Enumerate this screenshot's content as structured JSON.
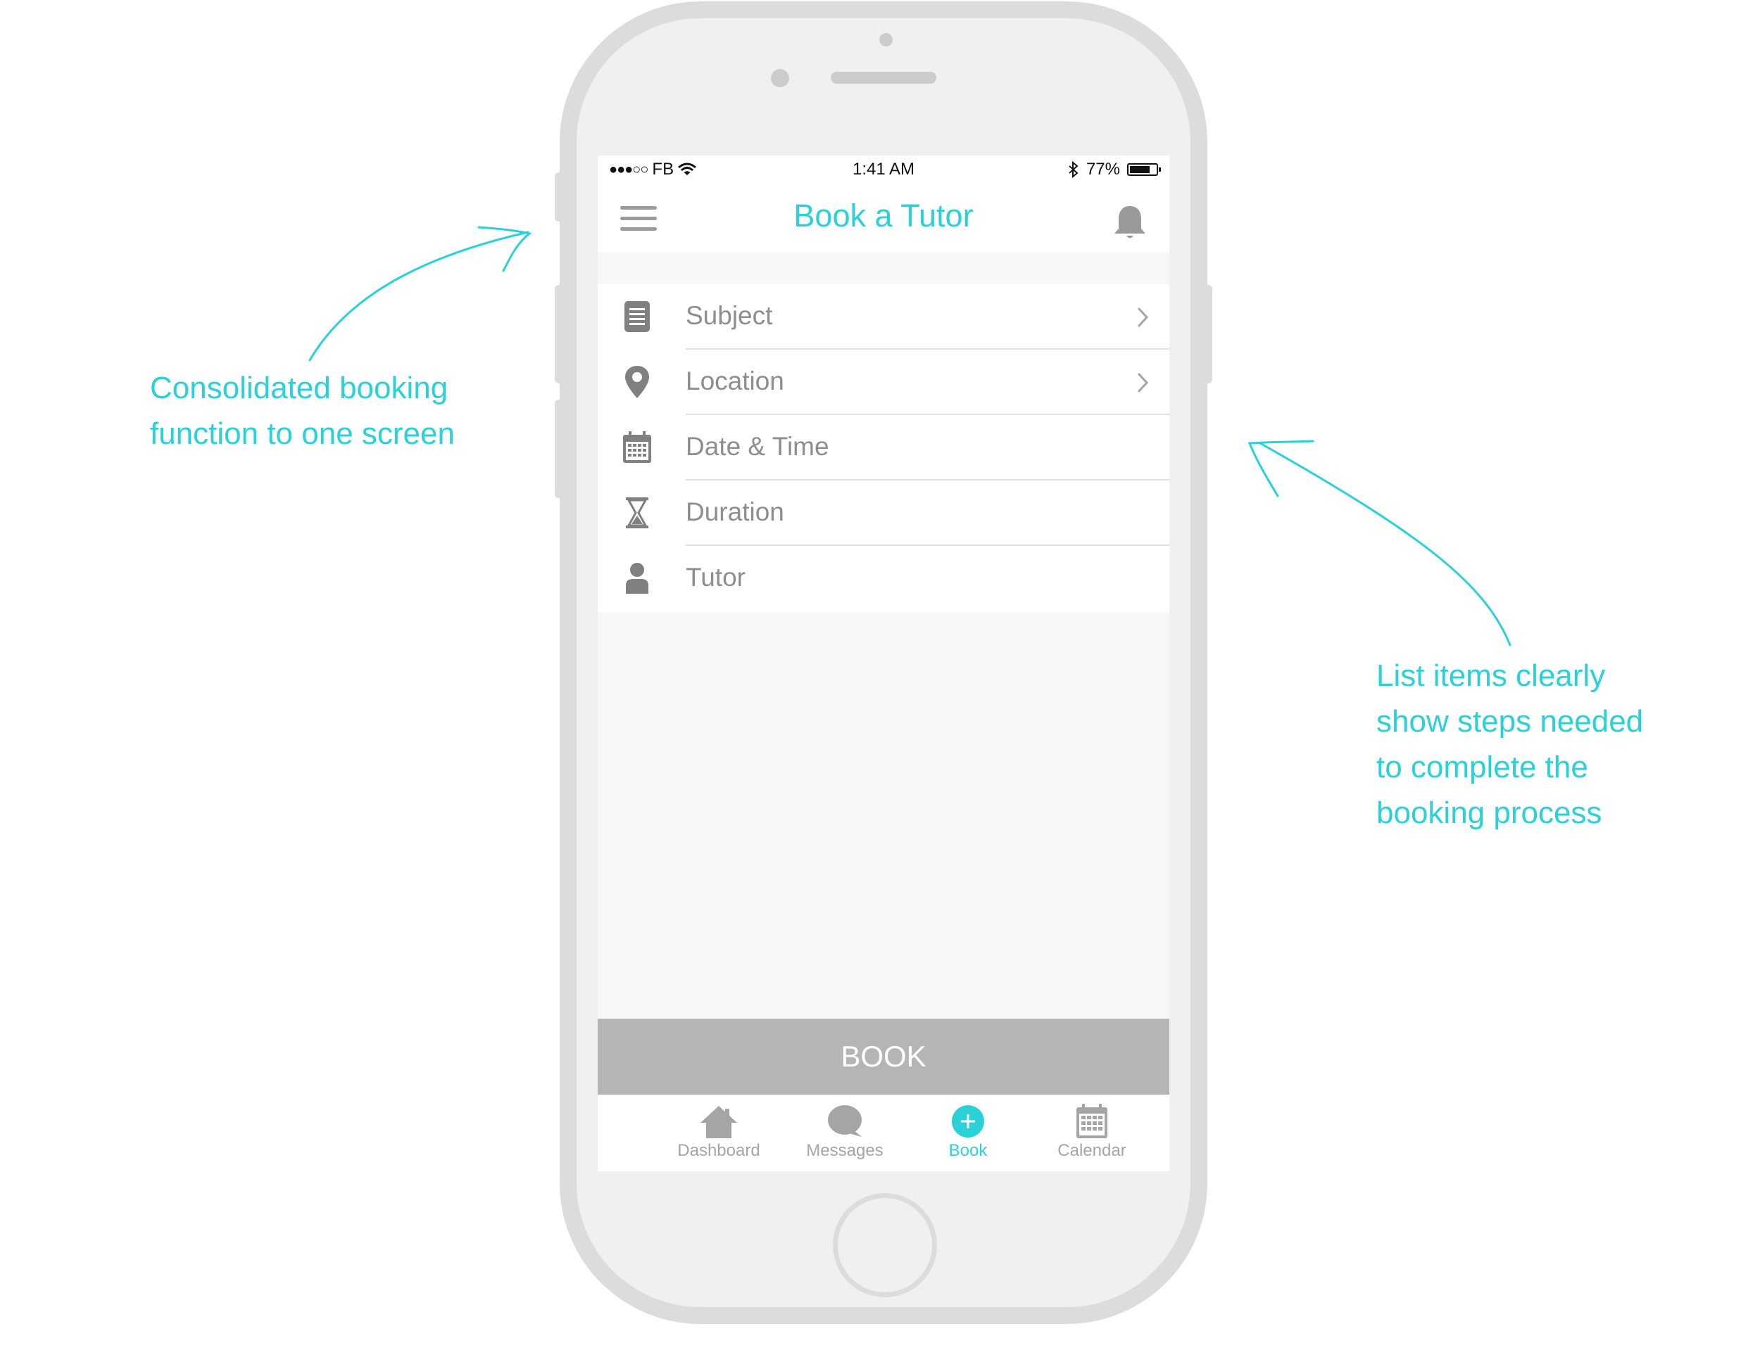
{
  "status_bar": {
    "carrier": "FB",
    "time": "1:41 AM",
    "battery": "77%"
  },
  "header": {
    "title": "Book a Tutor"
  },
  "booking_list": [
    {
      "label": "Subject",
      "icon": "document-icon",
      "has_chevron": true
    },
    {
      "label": "Location",
      "icon": "location-pin-icon",
      "has_chevron": true
    },
    {
      "label": "Date & Time",
      "icon": "calendar-icon",
      "has_chevron": false
    },
    {
      "label": "Duration",
      "icon": "hourglass-icon",
      "has_chevron": false
    },
    {
      "label": "Tutor",
      "icon": "person-icon",
      "has_chevron": false
    }
  ],
  "book_button": {
    "label": "BOOK"
  },
  "tab_bar": [
    {
      "label": "Dashboard",
      "icon": "home-icon",
      "active": false
    },
    {
      "label": "Messages",
      "icon": "chat-bubble-icon",
      "active": false
    },
    {
      "label": "Book",
      "icon": "plus-circle-icon",
      "active": true
    },
    {
      "label": "Calendar",
      "icon": "calendar-icon",
      "active": false
    }
  ],
  "annotations": {
    "left": [
      "Consolidated booking",
      "function to one screen"
    ],
    "right": [
      "List items clearly",
      "show steps needed",
      "to complete the",
      "booking process"
    ]
  },
  "colors": {
    "accent": "#2ad1d6",
    "icon_gray": "#808080",
    "book_button_bg": "#b5b5b5",
    "phone_frame": "#dcdcdc"
  }
}
